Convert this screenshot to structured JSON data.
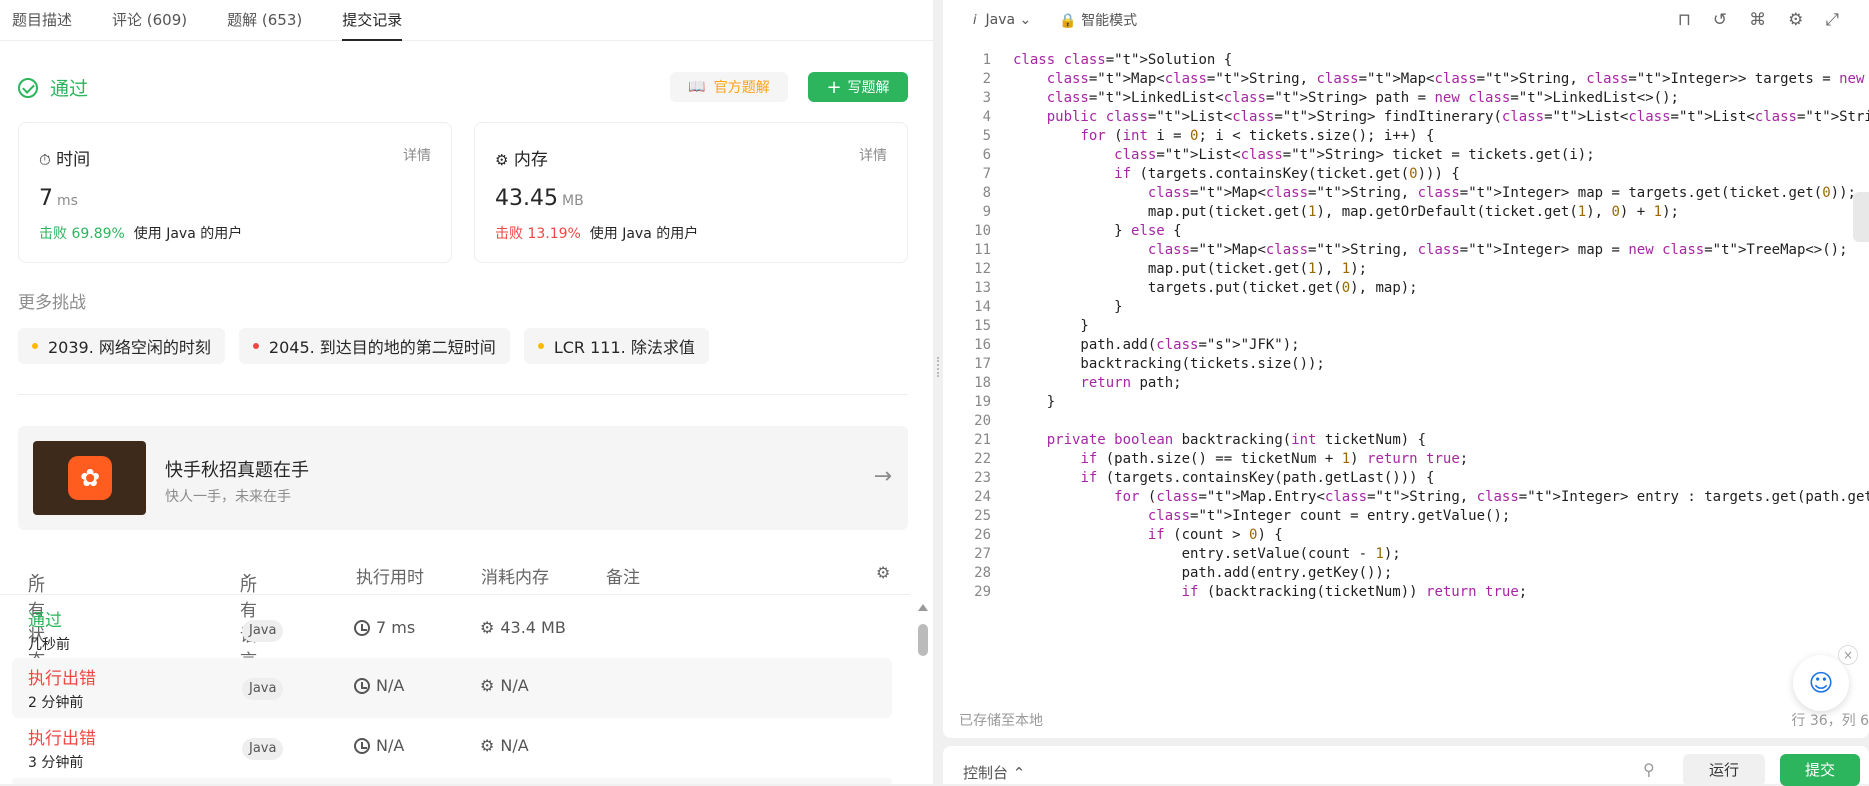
{
  "tabs": [
    "题目描述",
    "评论 (609)",
    "题解 (653)",
    "提交记录"
  ],
  "result": {
    "title": "通过",
    "official_label": "官方题解",
    "write_label": "写题解"
  },
  "time_card": {
    "title": "时间",
    "detail": "详情",
    "value": "7",
    "unit": "ms",
    "beat": "击败 69.89%",
    "beat_suffix": "使用 Java 的用户"
  },
  "mem_card": {
    "title": "内存",
    "detail": "详情",
    "value": "43.45",
    "unit": "MB",
    "beat": "击败 13.19%",
    "beat_suffix": "使用 Java 的用户"
  },
  "more": {
    "title": "更多挑战",
    "chips": [
      {
        "label": "2039. 网络空闲的时刻",
        "color": "#ffb800"
      },
      {
        "label": "2045. 到达目的地的第二短时间",
        "color": "#ef4743"
      },
      {
        "label": "LCR 111. 除法求值",
        "color": "#ffb800"
      }
    ]
  },
  "ad": {
    "title": "快手秋招真题在手",
    "subtitle": "快人一手，未来在手"
  },
  "table": {
    "headers": {
      "status": "所有状态",
      "lang": "所有语言",
      "runtime": "执行用时",
      "memory": "消耗内存",
      "note": "备注"
    },
    "rows": [
      {
        "status": "通过",
        "time": "几秒前",
        "lang": "Java",
        "runtime": "7 ms",
        "memory": "43.4 MB",
        "status_color": "#2db55d"
      },
      {
        "status": "执行出错",
        "time": "2 分钟前",
        "lang": "Java",
        "runtime": "N/A",
        "memory": "N/A",
        "status_color": "#ef4743"
      },
      {
        "status": "执行出错",
        "time": "3 分钟前",
        "lang": "Java",
        "runtime": "N/A",
        "memory": "N/A",
        "status_color": "#ef4743"
      }
    ]
  },
  "editor": {
    "language": "Java",
    "mode": "智能模式",
    "status_left": "已存储至本地",
    "status_right": "行 36，列 6",
    "console": "控制台",
    "run": "运行",
    "submit": "提交",
    "lines": [
      "class Solution {",
      "    Map<String, Map<String, Integer>> targets = new HashMap<>();",
      "    LinkedList<String> path = new LinkedList<>();",
      "    public List<String> findItinerary(List<List<String>> tickets) {",
      "        for (int i = 0; i < tickets.size(); i++) {",
      "            List<String> ticket = tickets.get(i);",
      "            if (targets.containsKey(ticket.get(0))) {",
      "                Map<String, Integer> map = targets.get(ticket.get(0));",
      "                map.put(ticket.get(1), map.getOrDefault(ticket.get(1), 0) + 1);",
      "            } else {",
      "                Map<String, Integer> map = new TreeMap<>();",
      "                map.put(ticket.get(1), 1);",
      "                targets.put(ticket.get(0), map);",
      "            }",
      "        }",
      "        path.add(\"JFK\");",
      "        backtracking(tickets.size());",
      "        return path;",
      "    }",
      "",
      "    private boolean backtracking(int ticketNum) {",
      "        if (path.size() == ticketNum + 1) return true;",
      "        if (targets.containsKey(path.getLast())) {",
      "            for (Map.Entry<String, Integer> entry : targets.get(path.getLast()).entrySet()) {",
      "                Integer count = entry.getValue();",
      "                if (count > 0) {",
      "                    entry.setValue(count - 1);",
      "                    path.add(entry.getKey());",
      "                    if (backtracking(ticketNum)) return true;"
    ]
  }
}
